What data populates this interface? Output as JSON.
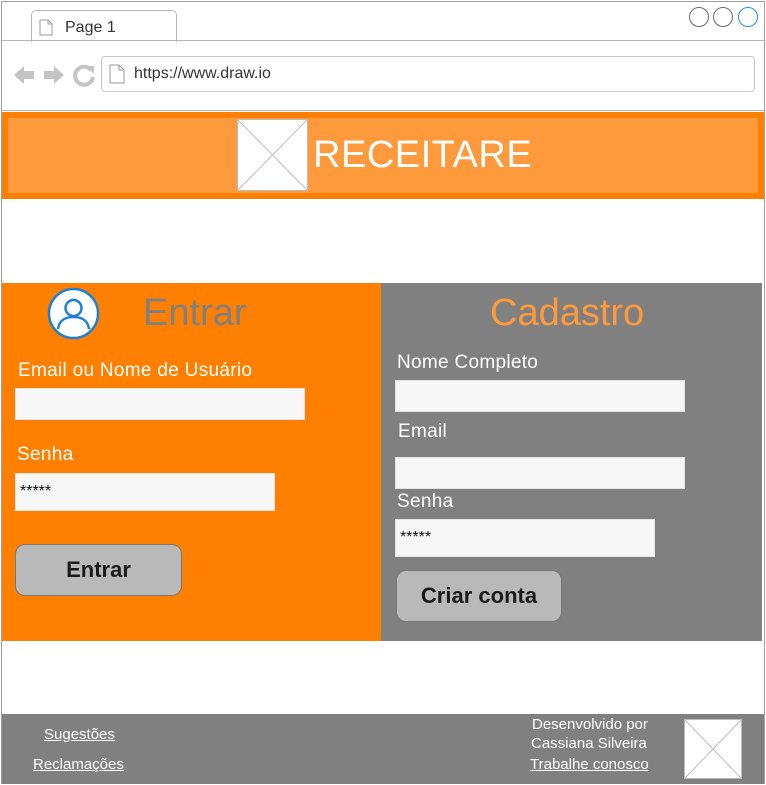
{
  "browser": {
    "tab_title": "Page 1",
    "url": "https://www.draw.io"
  },
  "header": {
    "title": "RECEITARE"
  },
  "login": {
    "title": "Entrar",
    "username_label": "Email ou Nome de Usuário",
    "username_value": "",
    "password_label": "Senha",
    "password_value": "*****",
    "submit_label": "Entrar"
  },
  "signup": {
    "title": "Cadastro",
    "name_label": "Nome Completo",
    "name_value": "",
    "email_label": "Email",
    "email_value": "",
    "password_label": "Senha",
    "password_value": "*****",
    "submit_label": "Criar conta"
  },
  "footer": {
    "suggestions_link": "Sugestões",
    "complaints_link": "Reclamações",
    "developed_by": "Desenvolvido por",
    "author": "Cassiana Silveira",
    "careers_link": "Trabalhe conosco"
  },
  "colors": {
    "brand_orange": "#ff7f00",
    "header_inner_orange": "#ff9a3c",
    "panel_gray": "#808080",
    "button_gray": "#b9b9b9"
  },
  "icons": [
    "page-icon",
    "back-arrow-icon",
    "forward-arrow-icon",
    "refresh-icon",
    "user-avatar-icon",
    "image-placeholder-icon"
  ]
}
